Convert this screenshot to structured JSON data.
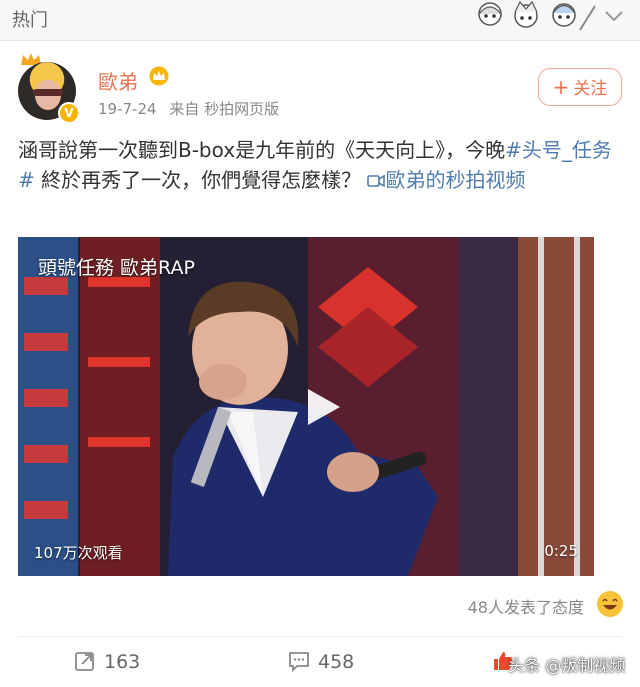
{
  "topbar": {
    "title": "热门"
  },
  "post": {
    "username": "歐弟",
    "date": "19-7-24",
    "source": "来自 秒拍网页版",
    "follow_label": "关注",
    "text_before": "涵哥說第一次聽到B-box是九年前的《天天向上》，今晚",
    "hashtag": "#头号_任务#",
    "text_after": " 終於再秀了一次，你們覺得怎麼樣？ ",
    "video_link_text": "歐弟的秒拍视频"
  },
  "video": {
    "title": "頭號任務 歐弟RAP",
    "views": "107万次观看",
    "duration": "0:25"
  },
  "reactions": {
    "summary": "48人发表了态度"
  },
  "actions": {
    "reposts": "163",
    "comments": "458"
  },
  "watermark": "头条 @叛制视频",
  "colors": {
    "accent": "#eb7350",
    "link": "#507daf",
    "muted": "#888888"
  },
  "icons": [
    "chevron-down-icon",
    "crown-icon",
    "verified-badge-icon",
    "video-link-icon",
    "play-icon",
    "laugh-emoji-icon",
    "repost-icon",
    "comment-icon",
    "like-icon"
  ]
}
